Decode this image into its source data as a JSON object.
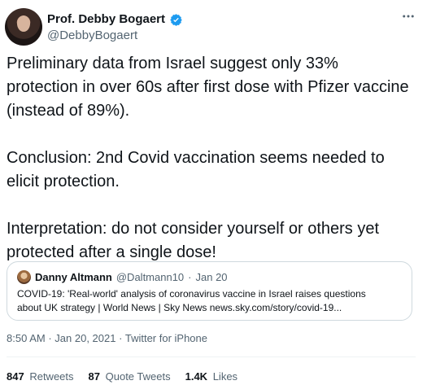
{
  "author": {
    "display_name": "Prof. Debby Bogaert",
    "handle": "@DebbyBogaert",
    "verified_icon": "verified-badge-icon",
    "more_icon": "more-icon"
  },
  "tweet": {
    "text": "Preliminary data from Israel suggest only 33%\nprotection in over 60s after first dose with Pfizer vaccine\n(instead of 89%).\n\nConclusion: 2nd Covid vaccination seems needed to\nelicit protection.\n\nInterpretation: do not consider yourself or others yet\nprotected after a single dose!"
  },
  "quote": {
    "author_name": "Danny Altmann",
    "author_handle": "@Daltmann10",
    "separator": "·",
    "date": "Jan 20",
    "text": "COVID-19: 'Real-world' analysis of coronavirus vaccine in Israel raises questions\nabout UK strategy | World News | Sky News news.sky.com/story/covid-19..."
  },
  "meta": {
    "time": "8:50 AM",
    "date": "Jan 20, 2021",
    "source": "Twitter for iPhone",
    "sep1": "·",
    "sep2": "·"
  },
  "stats": {
    "retweets_count": "847",
    "retweets_label": "Retweets",
    "quotes_count": "87",
    "quotes_label": "Quote Tweets",
    "likes_count": "1.4K",
    "likes_label": "Likes"
  },
  "colors": {
    "verified_blue": "#1d9bf0",
    "text_primary": "#0f1419",
    "text_secondary": "#536471",
    "border": "#cfd9de"
  }
}
